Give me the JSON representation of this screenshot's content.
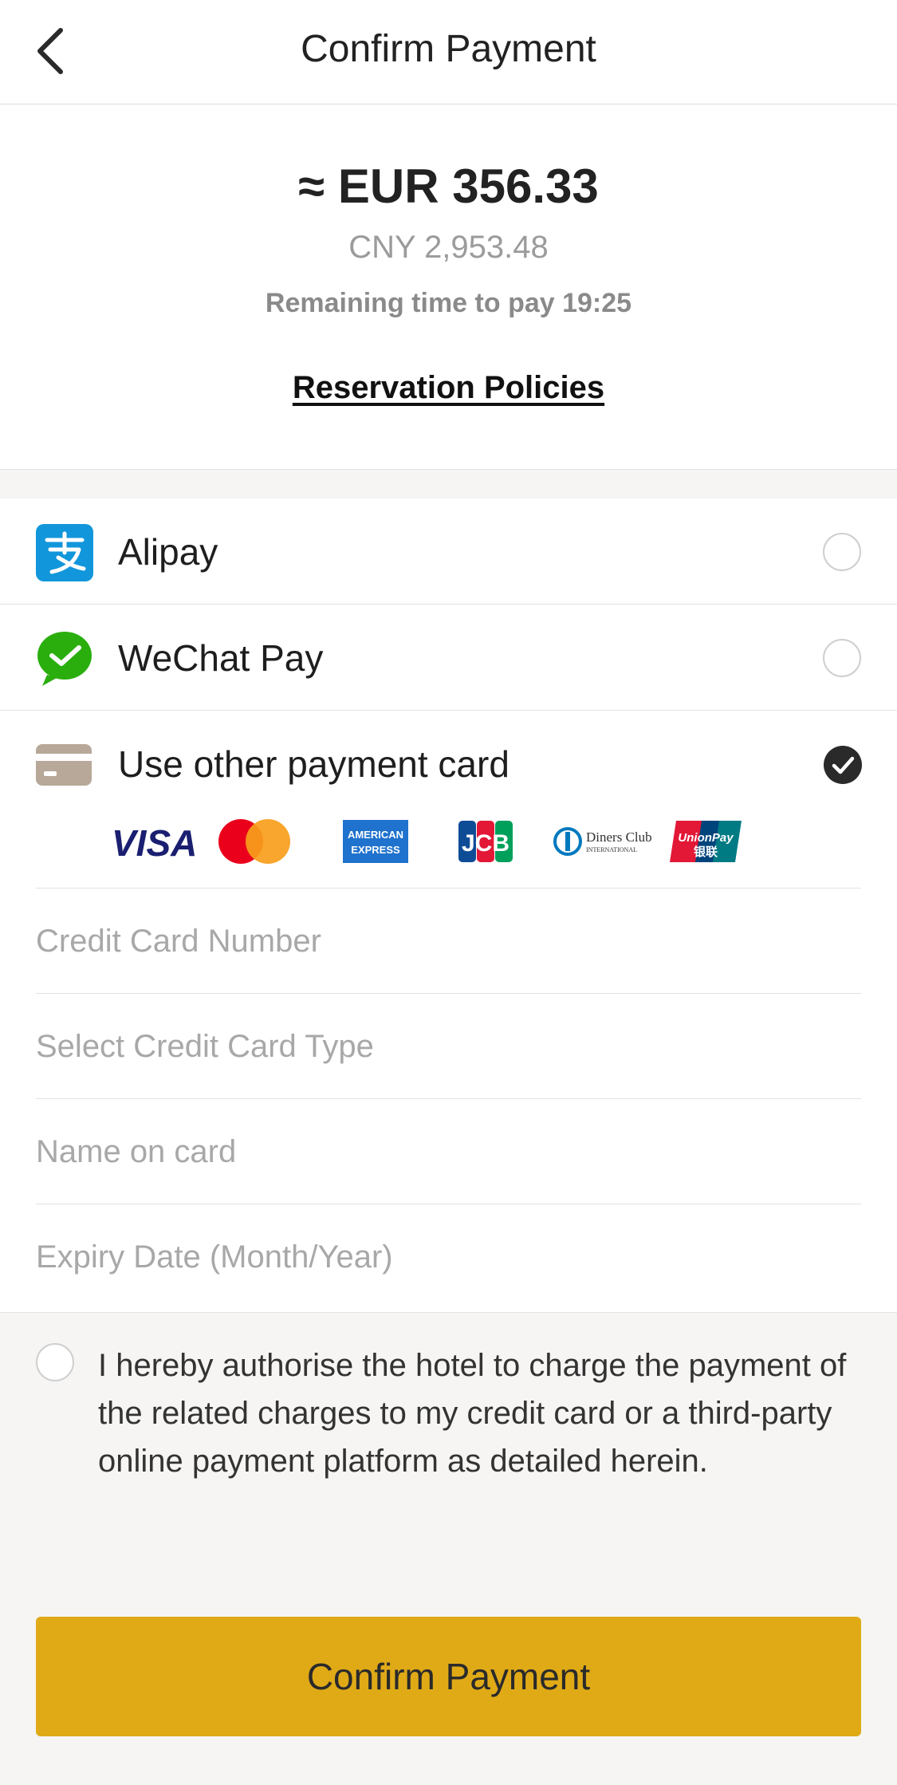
{
  "header": {
    "title": "Confirm Payment",
    "back_icon": "chevron-left-icon"
  },
  "amount": {
    "main": "≈ EUR 356.33",
    "local": "CNY 2,953.48",
    "remaining": "Remaining time to pay 19:25",
    "policies_link": "Reservation Policies"
  },
  "payment_methods": [
    {
      "label": "Alipay",
      "icon": "alipay-icon",
      "selected": false,
      "color": "#1296db"
    },
    {
      "label": "WeChat Pay",
      "icon": "wechat-pay-icon",
      "selected": false,
      "color": "#2aae0e"
    },
    {
      "label": "Use other payment card",
      "icon": "credit-card-icon",
      "selected": true,
      "color": "#b7a899"
    }
  ],
  "card_brands": [
    "VISA",
    "Mastercard",
    "AMERICAN EXPRESS",
    "JCB",
    "Diners Club INTERNATIONAL",
    "UnionPay 银联"
  ],
  "card_form": {
    "card_number_placeholder": "Credit Card Number",
    "card_type_placeholder": "Select Credit Card Type",
    "name_placeholder": "Name on card",
    "expiry_placeholder": "Expiry Date (Month/Year)"
  },
  "consent": {
    "text": "I hereby authorise the hotel to charge the payment of the related charges to my credit card or a third-party online payment platform as detailed herein.",
    "checked": false
  },
  "confirm_button": {
    "label": "Confirm Payment",
    "color": "#e0aa17"
  }
}
